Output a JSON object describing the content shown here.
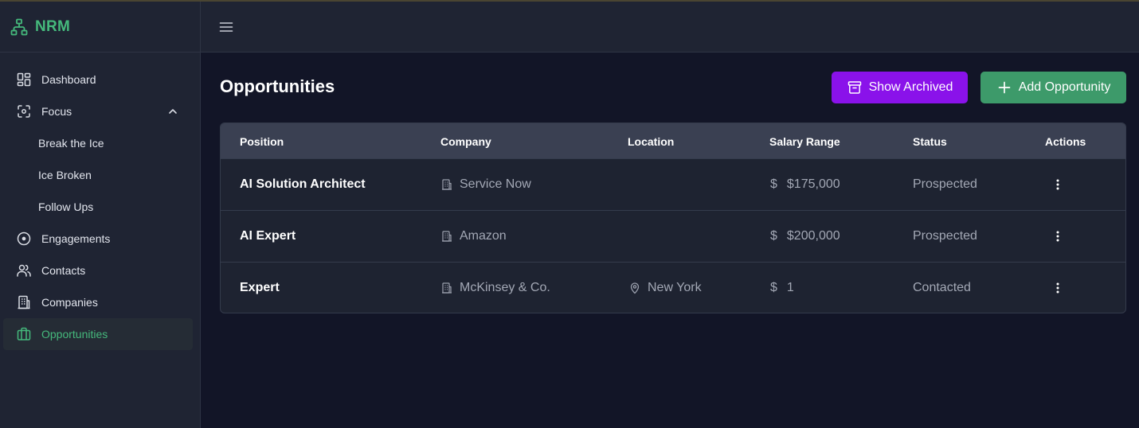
{
  "brand": {
    "name": "NRM",
    "icon": "sitemap-icon",
    "color": "#45b97c"
  },
  "sidebar": {
    "items": [
      {
        "label": "Dashboard",
        "icon": "dashboard-grid-icon"
      },
      {
        "label": "Focus",
        "icon": "focus-icon",
        "expanded": true
      },
      {
        "label": "Break the Ice"
      },
      {
        "label": "Ice Broken"
      },
      {
        "label": "Follow Ups"
      },
      {
        "label": "Engagements",
        "icon": "target-circle-icon"
      },
      {
        "label": "Contacts",
        "icon": "users-icon"
      },
      {
        "label": "Companies",
        "icon": "building-icon"
      },
      {
        "label": "Opportunities",
        "icon": "briefcase-icon",
        "active": true
      }
    ]
  },
  "topbar": {
    "menu_icon": "hamburger-menu-icon"
  },
  "main": {
    "title": "Opportunities",
    "show_archived_label": "Show Archived",
    "add_opportunity_label": "Add Opportunity",
    "colors": {
      "archived_button": "#8a12ea",
      "add_button": "#3d9a6a"
    }
  },
  "table": {
    "columns": [
      "Position",
      "Company",
      "Location",
      "Salary Range",
      "Status",
      "Actions"
    ],
    "rows": [
      {
        "position": "AI Solution Architect",
        "company": "Service Now",
        "location": "",
        "salary_symbol": "$",
        "salary": "$175,000",
        "status": "Prospected"
      },
      {
        "position": "AI Expert",
        "company": "Amazon",
        "location": "",
        "salary_symbol": "$",
        "salary": "$200,000",
        "status": "Prospected"
      },
      {
        "position": "Expert",
        "company": "McKinsey & Co.",
        "location": "New York",
        "salary_symbol": "$",
        "salary": "1",
        "status": "Contacted"
      }
    ]
  }
}
